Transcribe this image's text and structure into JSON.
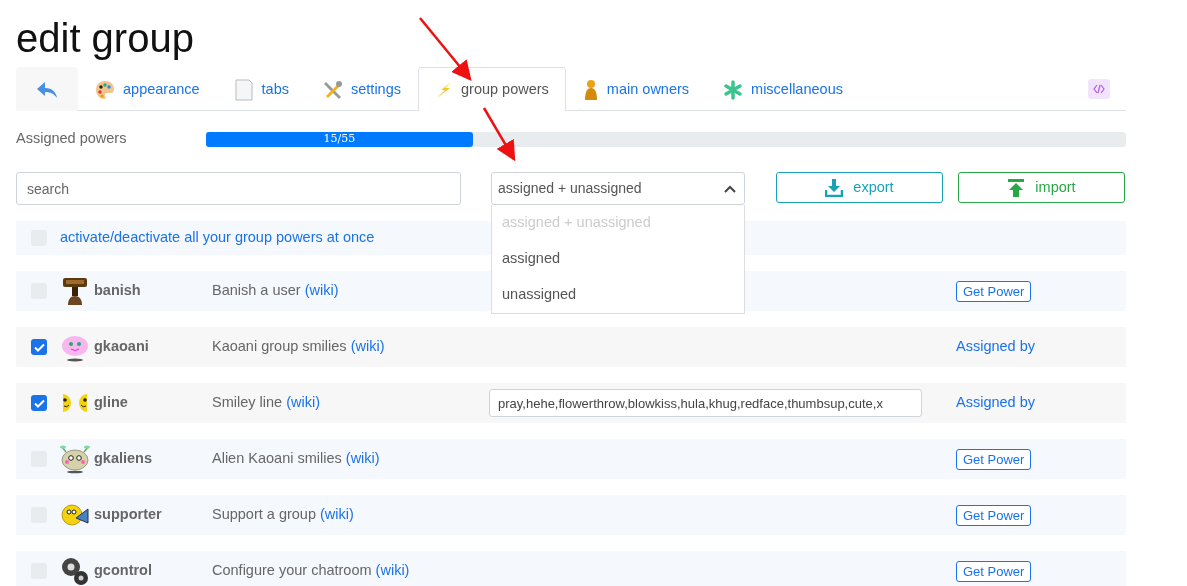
{
  "title": "edit group",
  "tabs": [
    {
      "kind": "back",
      "selected": false
    },
    {
      "kind": "tab",
      "label": "appearance",
      "selected": false
    },
    {
      "kind": "tab",
      "label": "tabs",
      "selected": false
    },
    {
      "kind": "tab",
      "label": "settings",
      "selected": false
    },
    {
      "kind": "tab",
      "label": "group powers",
      "selected": true
    },
    {
      "kind": "tab",
      "label": "main owners",
      "selected": false
    },
    {
      "kind": "tab",
      "label": "miscellaneous",
      "selected": false
    },
    {
      "kind": "code"
    }
  ],
  "progress": {
    "label": "Assigned powers",
    "level": 0.29,
    "reading": "15/55"
  },
  "search": {
    "placeholder": "search"
  },
  "filter": {
    "value": "assigned + unassigned",
    "expanded": true,
    "options": [
      {
        "label": "assigned + unassigned",
        "disabled": true
      },
      {
        "label": "assigned",
        "disabled": false
      },
      {
        "label": "unassigned",
        "disabled": false
      }
    ]
  },
  "buttons": [
    {
      "kind": "export",
      "label": "export"
    },
    {
      "kind": "import",
      "label": "import"
    }
  ],
  "activate_all": {
    "label": "activate/deactivate all your group powers at once",
    "checked": false
  },
  "powers": [
    {
      "name": "banish",
      "description": "Banish a user",
      "link": "(wiki)",
      "checked": false,
      "kind": "get",
      "action": "Get Power"
    },
    {
      "name": "gkaoani",
      "description": "Kaoani group smilies",
      "link": "(wiki)",
      "checked": true,
      "kind": "assigned",
      "action": "Assigned by"
    },
    {
      "name": "gline",
      "description": "Smiley line",
      "link": "(wiki)",
      "checked": true,
      "kind": "assigned",
      "action": "Assigned by",
      "input_value": "pray,hehe,flowerthrow,blowkiss,hula,khug,redface,thumbsup,cute,x"
    },
    {
      "name": "gkaliens",
      "description": "Alien Kaoani smilies",
      "link": "(wiki)",
      "checked": false,
      "kind": "get",
      "action": "Get Power"
    },
    {
      "name": "supporter",
      "description": "Support a group",
      "link": "(wiki)",
      "checked": false,
      "kind": "get",
      "action": "Get Power"
    },
    {
      "name": "gcontrol",
      "description": "Configure your chatroom",
      "link": "(wiki)",
      "checked": false,
      "kind": "get",
      "action": "Get Power"
    }
  ]
}
